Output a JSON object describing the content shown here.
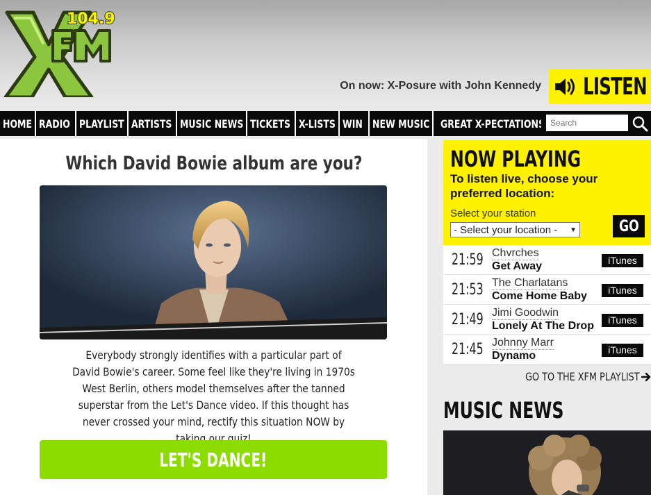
{
  "brand": {
    "logo_freq": "104.9",
    "logo_text": "XFM",
    "accent": "#fff200",
    "green": "#8cdc00",
    "nav_bg": "#0a0a0a"
  },
  "header": {
    "on_now": "On now: X-Posure with John Kennedy",
    "listen_label": "LISTEN",
    "listen_icon": "speaker-icon"
  },
  "nav": {
    "items": [
      {
        "label": "HOME"
      },
      {
        "label": "RADIO"
      },
      {
        "label": "PLAYLIST"
      },
      {
        "label": "ARTISTS"
      },
      {
        "label": "MUSIC NEWS"
      },
      {
        "label": "TICKETS"
      },
      {
        "label": "X-LISTS"
      },
      {
        "label": "WIN"
      },
      {
        "label": "NEW MUSIC"
      },
      {
        "label": "GREAT X-PECTATIONS"
      }
    ],
    "search_placeholder": "Search",
    "search_icon": "search-icon"
  },
  "article": {
    "title": "Which David Bowie album are you?",
    "body": "Everybody strongly identifies with a particular part of David Bowie's career. Some feel like they're living in 1970s West Berlin, others model themselves after the tanned superstar from the Let's Dance video. If this thought has never crossed your mind, rectify this situation NOW by taking our quiz!",
    "cta": "LET'S DANCE!"
  },
  "now_playing": {
    "title": "NOW PLAYING",
    "subtitle": "To listen live, choose your preferred location:",
    "select_label": "Select your station",
    "select_value": "- Select your location -",
    "go_label": "GO",
    "tracks": [
      {
        "time": "21:59",
        "artist": "Chvrches",
        "song": "Get Away",
        "store": "iTunes"
      },
      {
        "time": "21:53",
        "artist": "The Charlatans",
        "song": "Come Home Baby",
        "store": "iTunes"
      },
      {
        "time": "21:49",
        "artist": "Jimi Goodwin",
        "song": "Lonely At The Drop",
        "store": "iTunes"
      },
      {
        "time": "21:45",
        "artist": "Johnny Marr",
        "song": "Dynamo",
        "store": "iTunes"
      }
    ],
    "playlist_link": "GO TO THE XFM PLAYLIST"
  },
  "music_news": {
    "title": "MUSIC NEWS"
  }
}
